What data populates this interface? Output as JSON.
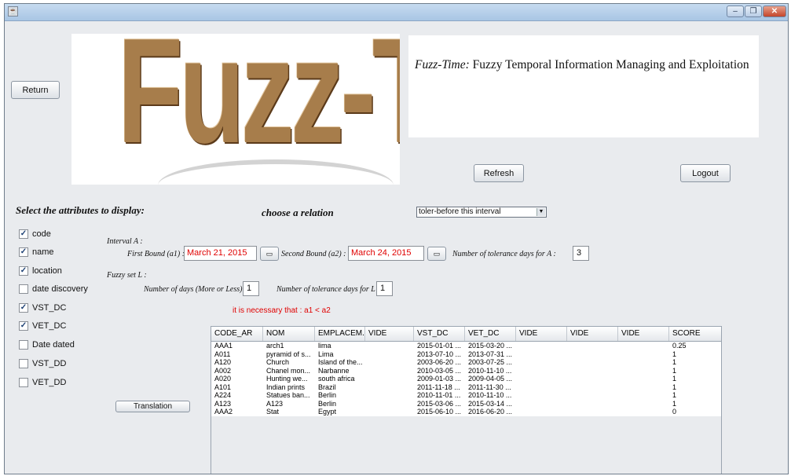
{
  "window": {
    "minimize": "–",
    "maximize": "❐",
    "close": "✕"
  },
  "buttons": {
    "return": "Return",
    "refresh": "Refresh",
    "logout": "Logout",
    "translation": "Translation"
  },
  "logo_text": "Fuzz-Time",
  "info": {
    "prefix": "Fuzz-Time:",
    "rest": " Fuzzy Temporal Information Managing and Exploitation"
  },
  "labels": {
    "select_attributes": "Select the attributes to display:",
    "choose_relation": "choose a relation",
    "interval_a": "Interval A :",
    "first_bound": "First Bound (a1) :",
    "second_bound": "Second Bound (a2) :",
    "tolerance_a": "Number of tolerance days for A :",
    "fuzzy_set": "Fuzzy set L :",
    "days_more_less": "Number of days (More or Less) :",
    "tolerance_l": "Number of tolerance days for L :",
    "warning": "it is necessary that : a1 < a2"
  },
  "relation_select": "toler-before this interval",
  "fields": {
    "first_bound": "March 21, 2015",
    "second_bound": "March 24, 2015",
    "tolerance_a": "3",
    "days_more_less": "1",
    "tolerance_l": "1"
  },
  "attributes": [
    {
      "label": "code",
      "checked": true
    },
    {
      "label": "name",
      "checked": true
    },
    {
      "label": "location",
      "checked": true
    },
    {
      "label": "date discovery",
      "checked": false
    },
    {
      "label": "VST_DC",
      "checked": true
    },
    {
      "label": "VET_DC",
      "checked": true
    },
    {
      "label": "Date dated",
      "checked": false
    },
    {
      "label": "VST_DD",
      "checked": false
    },
    {
      "label": "VET_DD",
      "checked": false
    }
  ],
  "table": {
    "headers": [
      "CODE_AR",
      "NOM",
      "EMPLACEM...",
      "VIDE",
      "VST_DC",
      "VET_DC",
      "VIDE",
      "VIDE",
      "VIDE",
      "SCORE"
    ],
    "rows": [
      [
        "AAA1",
        "arch1",
        "lima",
        "",
        "2015-01-01 ...",
        "2015-03-20 ...",
        "",
        "",
        "",
        "0.25"
      ],
      [
        "A011",
        "pyramid of s...",
        "Lima",
        "",
        "2013-07-10 ...",
        "2013-07-31 ...",
        "",
        "",
        "",
        "1"
      ],
      [
        "A120",
        "Church",
        "Island of the...",
        "",
        "2003-06-20 ...",
        "2003-07-25 ...",
        "",
        "",
        "",
        "1"
      ],
      [
        "A002",
        "Chanel mon...",
        "Narbanne",
        "",
        "2010-03-05 ...",
        "2010-11-10 ...",
        "",
        "",
        "",
        "1"
      ],
      [
        "A020",
        "Hunting we...",
        "south africa",
        "",
        "2009-01-03 ...",
        "2009-04-05 ...",
        "",
        "",
        "",
        "1"
      ],
      [
        "A101",
        "Indian prints",
        "Brazil",
        "",
        "2011-11-18 ...",
        "2011-11-30 ...",
        "",
        "",
        "",
        "1"
      ],
      [
        "A224",
        "Statues ban...",
        "Berlin",
        "",
        "2010-11-01 ...",
        "2010-11-10 ...",
        "",
        "",
        "",
        "1"
      ],
      [
        "A123",
        "A123",
        "Berlin",
        "",
        "2015-03-06 ...",
        "2015-03-14 ...",
        "",
        "",
        "",
        "1"
      ],
      [
        "AAA2",
        "Stat",
        "Egypt",
        "",
        "2015-06-10 ...",
        "2016-06-20 ...",
        "",
        "",
        "",
        "0"
      ]
    ]
  }
}
